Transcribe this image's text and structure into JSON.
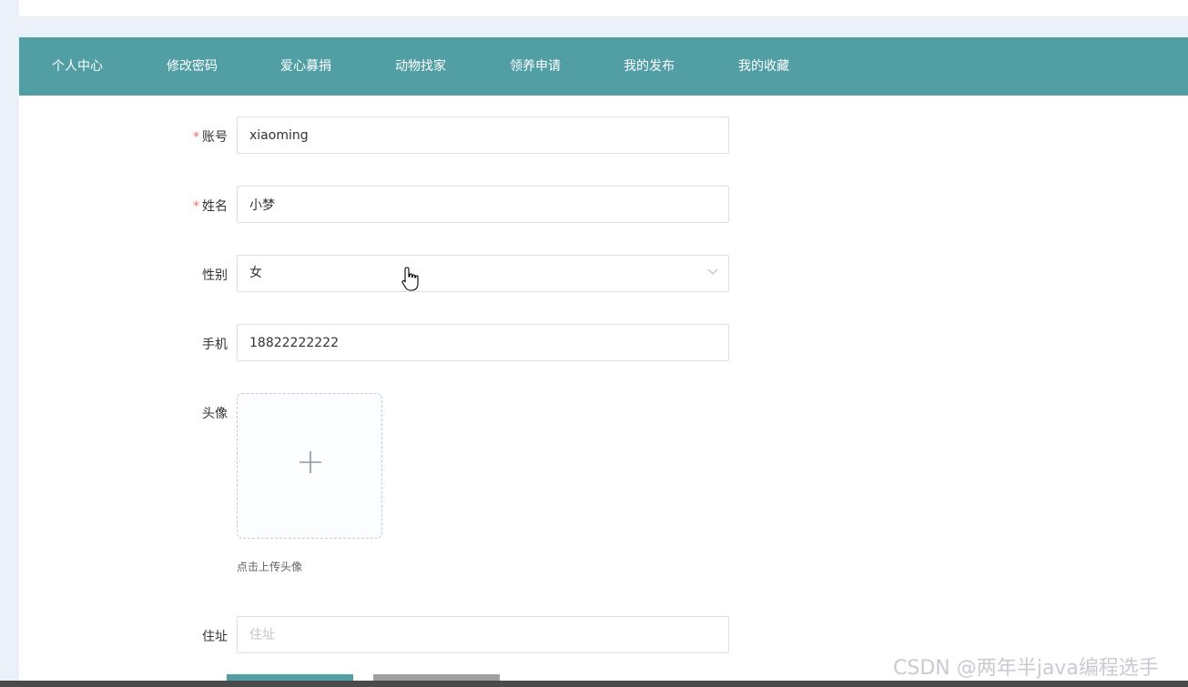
{
  "nav": {
    "items": [
      {
        "label": "个人中心"
      },
      {
        "label": "修改密码"
      },
      {
        "label": "爱心募捐"
      },
      {
        "label": "动物找家"
      },
      {
        "label": "领养申请"
      },
      {
        "label": "我的发布"
      },
      {
        "label": "我的收藏"
      }
    ],
    "background_color": "#519fa5"
  },
  "form": {
    "account": {
      "label": "账号",
      "value": "xiaoming",
      "required": true
    },
    "name": {
      "label": "姓名",
      "value": "小梦",
      "required": true
    },
    "gender": {
      "label": "性别",
      "value": "女",
      "icon": "chevron-down-icon"
    },
    "phone": {
      "label": "手机",
      "value": "18822222222"
    },
    "avatar": {
      "label": "头像",
      "tip": "点击上传头像",
      "icon": "plus-icon"
    },
    "address": {
      "label": "住址",
      "placeholder": "住址",
      "value": ""
    },
    "required_mark": "*"
  },
  "buttons": {
    "primary_color": "#519fa5",
    "secondary_color": "#a0a0a0"
  },
  "watermark": "CSDN @两年半java编程选手"
}
